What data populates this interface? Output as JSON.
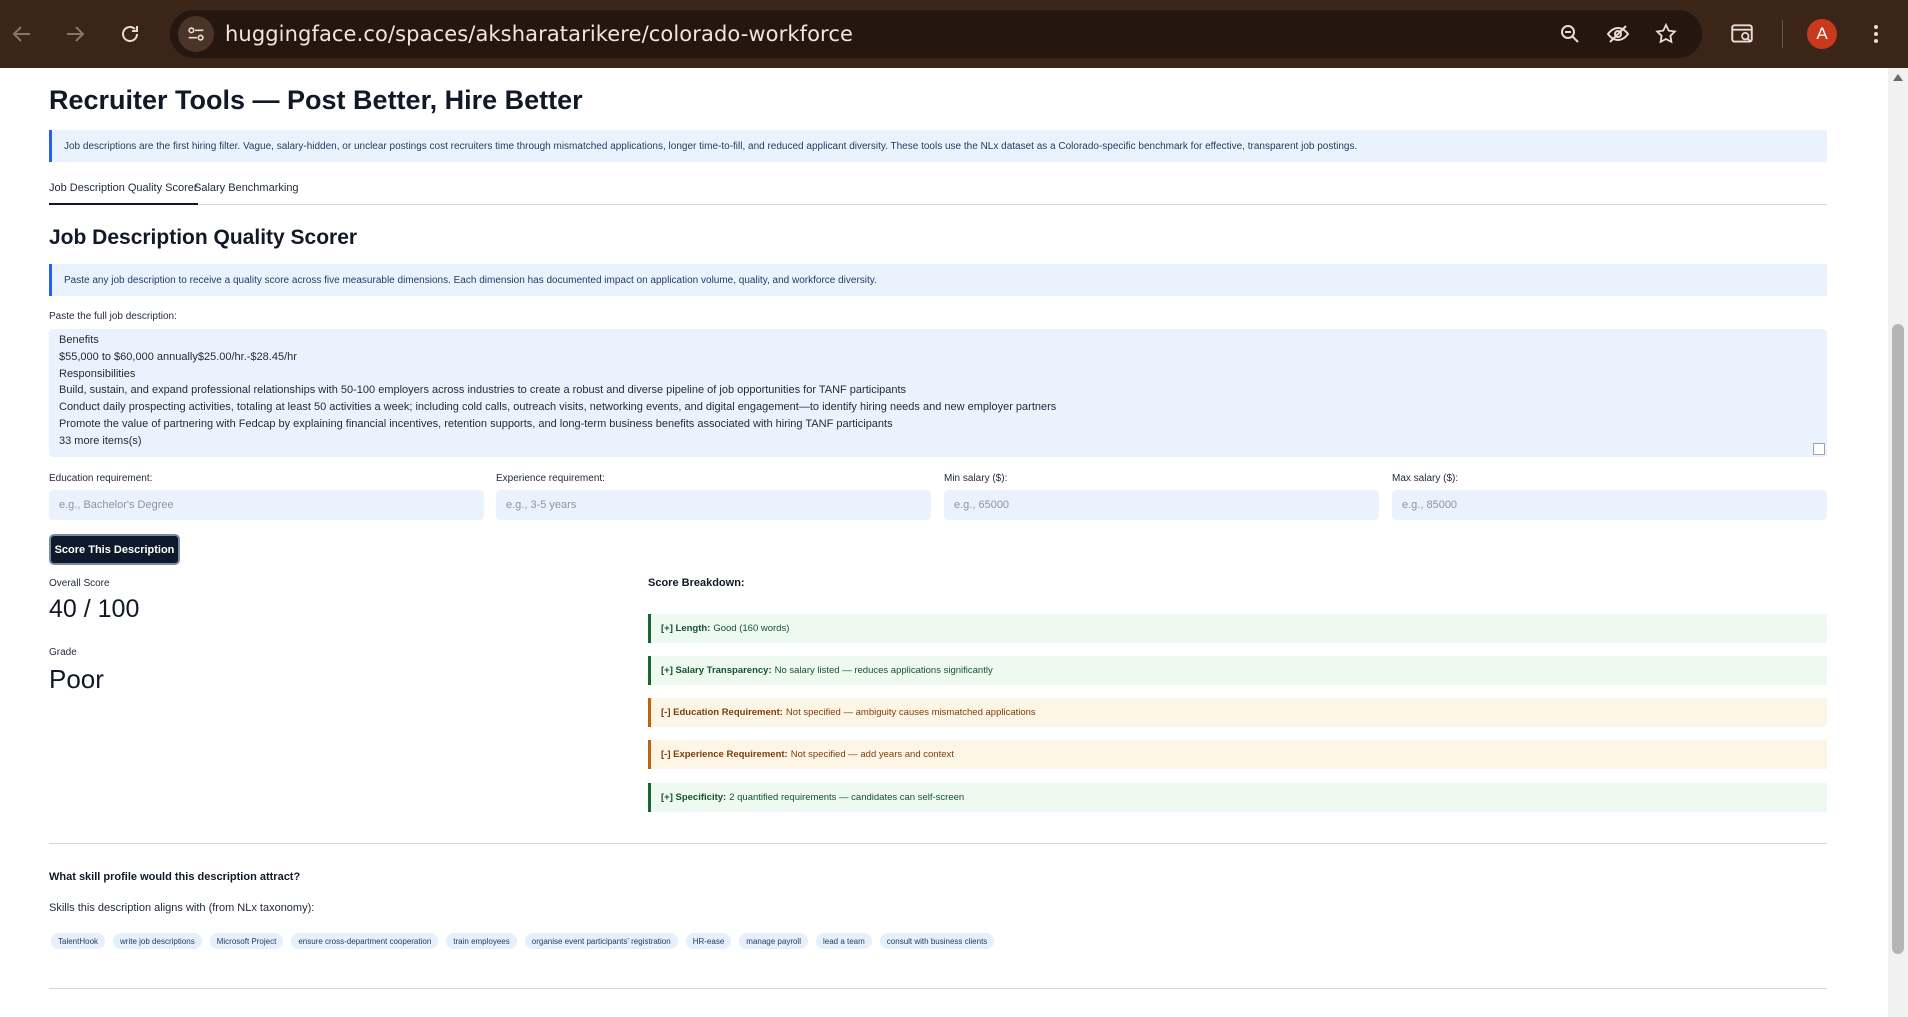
{
  "browser": {
    "url": "huggingface.co/spaces/aksharatarikere/colorado-workforce",
    "avatar_letter": "A"
  },
  "page": {
    "title": "Recruiter Tools — Post Better, Hire Better",
    "intro": "Job descriptions are the first hiring filter. Vague, salary-hidden, or unclear postings cost recruiters time through mismatched applications, longer time-to-fill, and reduced applicant diversity. These tools use the NLx dataset as a Colorado-specific benchmark for effective, transparent job postings.",
    "tabs": [
      {
        "label": "Job Description Quality Scorer",
        "active": true
      },
      {
        "label": "Salary Benchmarking",
        "active": false
      }
    ]
  },
  "scorer": {
    "heading": "Job Description Quality Scorer",
    "info": "Paste any job description to receive a quality score across five measurable dimensions. Each dimension has documented impact on application volume, quality, and workforce diversity.",
    "jd_label": "Paste the full job description:",
    "jd_lines": [
      "Benefits",
      "$55,000 to $60,000 annually$25.00/hr.-$28.45/hr",
      "Responsibilities",
      "Build, sustain, and expand professional relationships with 50-100 employers across industries to create a robust and diverse pipeline of job opportunities for TANF participants",
      "Conduct daily prospecting activities, totaling at least 50 activities a week; including cold calls, outreach visits, networking events, and digital engagement—to identify hiring needs and new employer partners",
      "Promote the value of partnering with Fedcap by explaining financial incentives, retention supports, and long-term business benefits associated with hiring TANF participants",
      "33 more items(s)"
    ],
    "fields": {
      "education": {
        "label": "Education requirement:",
        "placeholder": "e.g., Bachelor's Degree"
      },
      "experience": {
        "label": "Experience requirement:",
        "placeholder": "e.g., 3-5 years"
      },
      "min_salary": {
        "label": "Min salary ($):",
        "placeholder": "e.g., 65000"
      },
      "max_salary": {
        "label": "Max salary ($):",
        "placeholder": "e.g., 85000"
      }
    },
    "button": "Score This Description",
    "overall_label": "Overall Score",
    "overall_value": "40 / 100",
    "grade_label": "Grade",
    "grade_value": "Poor",
    "breakdown_title": "Score Breakdown:",
    "breakdown": [
      {
        "prefix": "[+] Length:",
        "text": "Good (160 words)",
        "status": "good"
      },
      {
        "prefix": "[+] Salary Transparency:",
        "text": "No salary listed — reduces applications significantly",
        "status": "good"
      },
      {
        "prefix": "[-] Education Requirement:",
        "text": "Not specified — ambiguity causes mismatched applications",
        "status": "warn"
      },
      {
        "prefix": "[-] Experience Requirement:",
        "text": "Not specified — add years and context",
        "status": "warn"
      },
      {
        "prefix": "[+] Specificity:",
        "text": "2 quantified requirements — candidates can self-screen",
        "status": "good"
      }
    ],
    "status_colors": {
      "good": "#166534",
      "warn": "#c2610c"
    }
  },
  "skills": {
    "question": "What skill profile would this description attract?",
    "intro": "Skills this description aligns with (from NLx taxonomy):",
    "chips": [
      "TalentHook",
      "write job descriptions",
      "Microsoft Project",
      "ensure cross-department cooperation",
      "train employees",
      "organise event participants' registration",
      "HR-ease",
      "manage payroll",
      "lead a team",
      "consult with business clients"
    ]
  },
  "icons": [
    "back-icon",
    "forward-icon",
    "reload-icon",
    "site-info-icon",
    "zoom-icon",
    "eye-off-icon",
    "star-icon",
    "search-tab-icon",
    "menu-icon"
  ]
}
